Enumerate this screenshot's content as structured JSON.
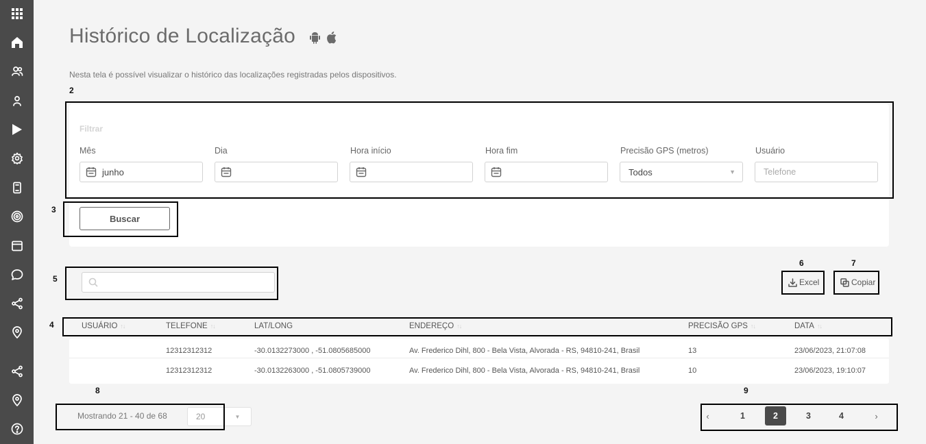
{
  "sidebar": {
    "items": [
      {
        "icon": "apps-grid-icon"
      },
      {
        "icon": "home-icon"
      },
      {
        "icon": "users-icon"
      },
      {
        "icon": "user-icon"
      },
      {
        "icon": "play-store-icon"
      },
      {
        "icon": "gear-icon"
      },
      {
        "icon": "device-icon"
      },
      {
        "icon": "radar-icon"
      },
      {
        "icon": "window-icon"
      },
      {
        "icon": "chat-icon"
      },
      {
        "icon": "share-icon"
      },
      {
        "icon": "location-pin-icon"
      },
      {
        "icon": "share-icon"
      },
      {
        "icon": "location-pin-icon"
      },
      {
        "icon": "help-icon"
      }
    ]
  },
  "header": {
    "title": "Histórico de Localização",
    "description": "Nesta tela é possível visualizar o histórico das localizações registradas pelos dispositivos."
  },
  "annotations": [
    "2",
    "3",
    "4",
    "5",
    "6",
    "7",
    "8",
    "9"
  ],
  "filter": {
    "title": "Filtrar",
    "fields": {
      "month": {
        "label": "Mês",
        "value": "junho"
      },
      "day": {
        "label": "Dia",
        "value": ""
      },
      "start_time": {
        "label": "Hora início",
        "value": ""
      },
      "end_time": {
        "label": "Hora fim",
        "value": ""
      },
      "gps_precision": {
        "label": "Precisão GPS (metros)",
        "value": "Todos"
      },
      "user": {
        "label": "Usuário",
        "placeholder": "Telefone"
      }
    },
    "search_button": "Buscar"
  },
  "toolbar": {
    "excel_label": "Excel",
    "copy_label": "Copiar"
  },
  "table": {
    "columns": [
      "USUÁRIO",
      "TELEFONE",
      "LAT/LONG",
      "ENDEREÇO",
      "PRECISÃO GPS",
      "DATA"
    ],
    "rows": [
      {
        "usuario": "",
        "telefone": "12312312312",
        "latlong": "-30.0132273000 , -51.0805685000",
        "endereco": "Av. Frederico Dihl, 800 - Bela Vista, Alvorada - RS, 94810-241, Brasil",
        "precisao": "13",
        "data": "23/06/2023, 21:07:08"
      },
      {
        "usuario": "",
        "telefone": "12312312312",
        "latlong": "-30.0132263000 , -51.0805739000",
        "endereco": "Av. Frederico Dihl, 800 - Bela Vista, Alvorada - RS, 94810-241, Brasil",
        "precisao": "10",
        "data": "23/06/2023, 19:10:07"
      }
    ]
  },
  "pagination": {
    "showing": "Mostrando 21 - 40 de 68",
    "page_size": "20",
    "prev": "‹",
    "next": "›",
    "pages": [
      "1",
      "2",
      "3",
      "4"
    ],
    "current": "2"
  }
}
